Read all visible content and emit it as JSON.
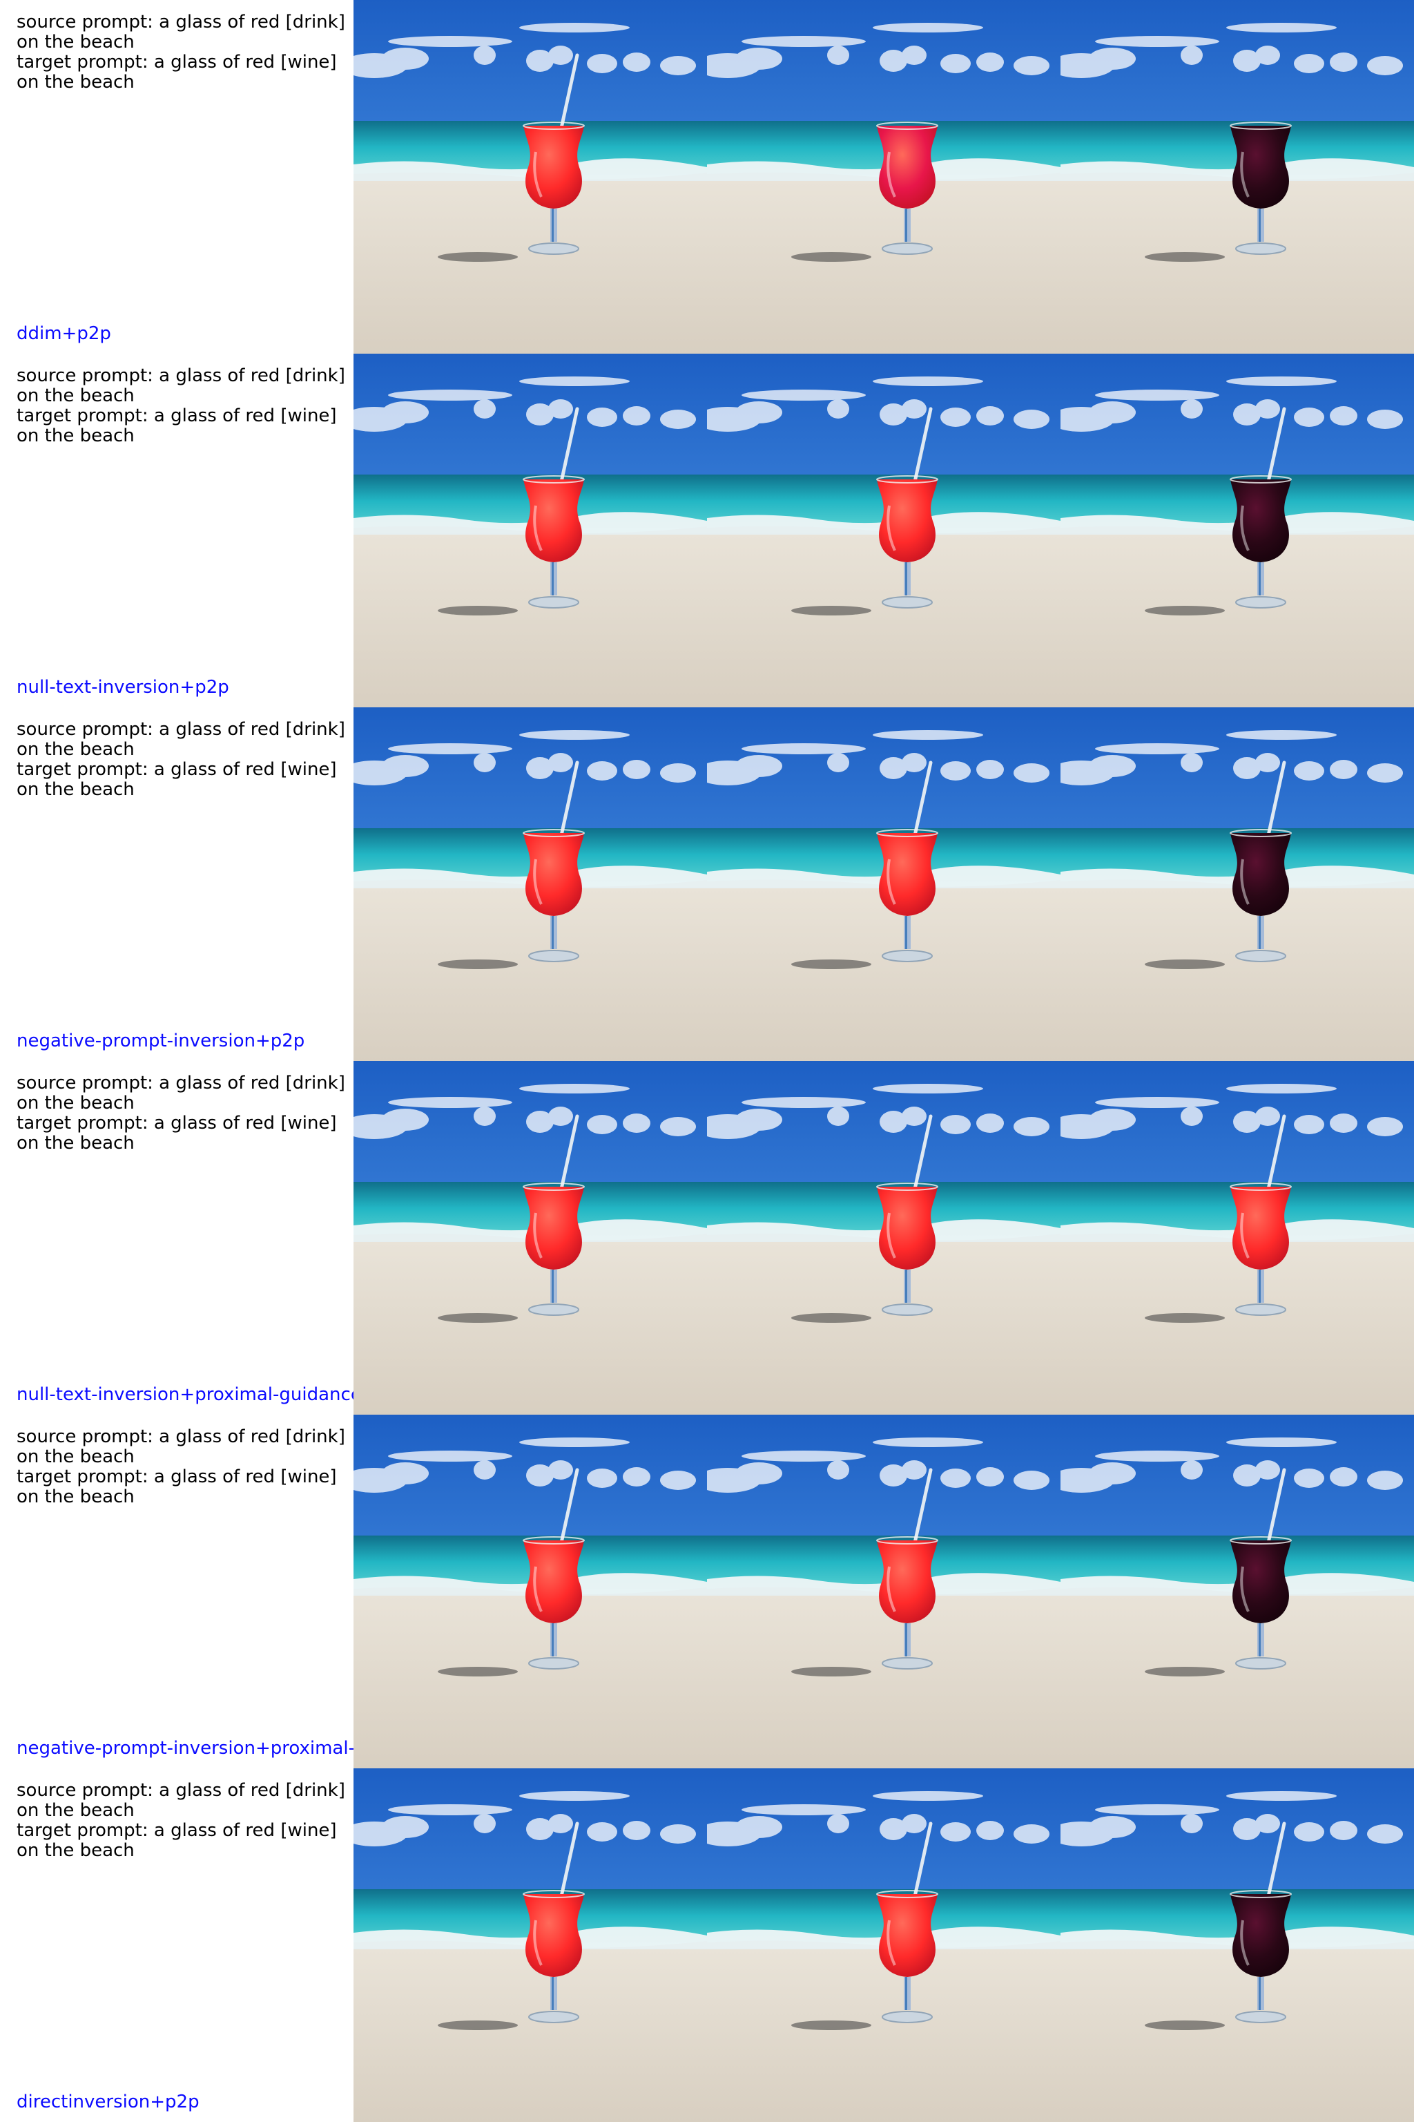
{
  "rows": [
    {
      "source_prompt": "source prompt: a glass of red [drink] on the beach",
      "target_prompt": "target prompt: a glass of red [wine] on the beach",
      "method": "ddim+p2p",
      "panels": [
        "source",
        "edit-pink",
        "edit-wine"
      ]
    },
    {
      "source_prompt": "source prompt: a glass of red [drink] on the beach",
      "target_prompt": "target prompt: a glass of red [wine] on the beach",
      "method": "null-text-inversion+p2p",
      "panels": [
        "source",
        "recon-red",
        "edit-wine"
      ]
    },
    {
      "source_prompt": "source prompt: a glass of red [drink] on the beach",
      "target_prompt": "target prompt: a glass of red [wine] on the beach",
      "method": "negative-prompt-inversion+p2p",
      "panels": [
        "source",
        "recon-red",
        "edit-wine"
      ]
    },
    {
      "source_prompt": "source prompt: a glass of red [drink] on the beach",
      "target_prompt": "target prompt: a glass of red [wine] on the beach",
      "method": "null-text-inversion+proximal-guidance",
      "panels": [
        "source",
        "recon-red",
        "edit-red"
      ]
    },
    {
      "source_prompt": "source prompt: a glass of red [drink] on the beach",
      "target_prompt": "target prompt: a glass of red [wine] on the beach",
      "method": "negative-prompt-inversion+proximal-g",
      "panels": [
        "source",
        "recon-red",
        "edit-wine"
      ]
    },
    {
      "source_prompt": "source prompt: a glass of red [drink] on the beach",
      "target_prompt": "target prompt: a glass of red [wine] on the beach",
      "method": "directinversion+p2p",
      "panels": [
        "source",
        "recon-red",
        "edit-wine"
      ]
    }
  ],
  "colors": {
    "drink_red": "#ff2a2a",
    "drink_pink": "#e8164a",
    "wine_dark": "#2a0716",
    "method_label": "#0b0bff"
  }
}
